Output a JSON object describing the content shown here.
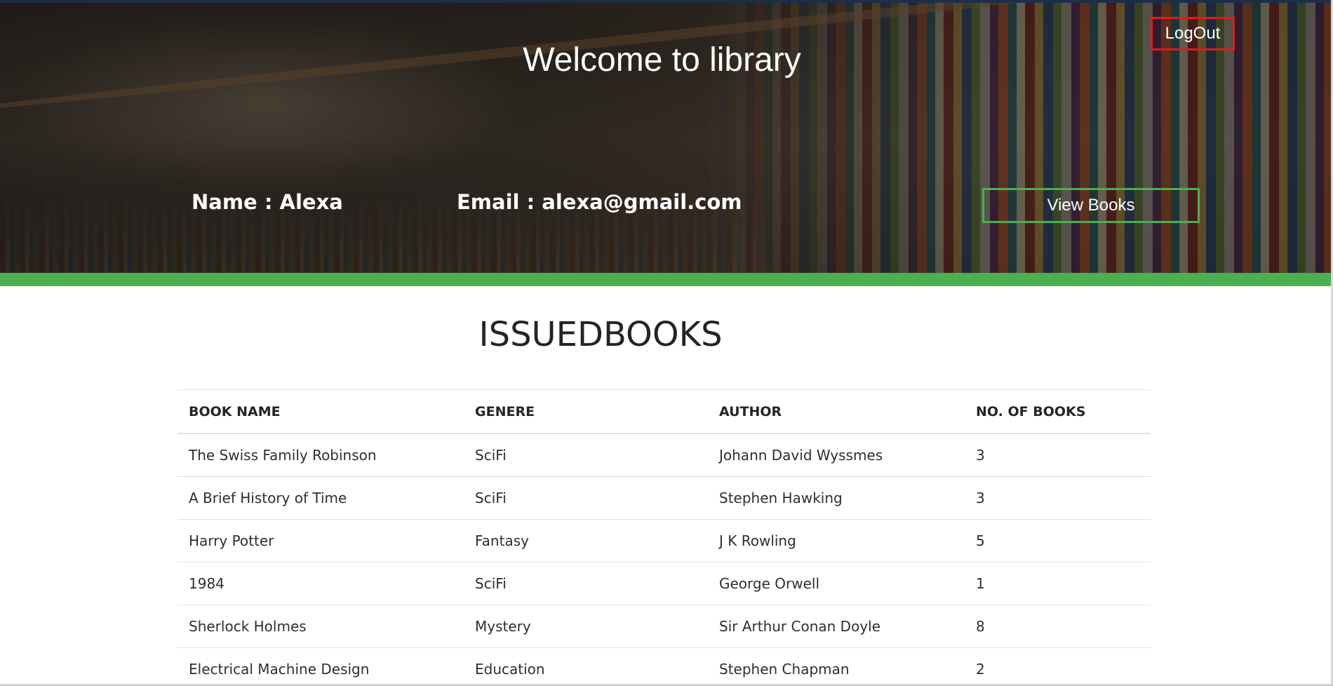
{
  "header": {
    "welcome_title": "Welcome to library",
    "logout_label": "LogOut",
    "name_text": "Name : Alexa",
    "email_text": "Email : alexa@gmail.com",
    "view_books_label": "View Books"
  },
  "colors": {
    "logout_border": "#e01b1b",
    "accent_green": "#4caf50",
    "text_dark": "#212529"
  },
  "issued_books": {
    "title": "ISSUEDBOOKS",
    "columns": [
      "BOOK NAME",
      "GENERE",
      "AUTHOR",
      "NO. OF BOOKS"
    ],
    "rows": [
      [
        "The Swiss Family Robinson",
        "SciFi",
        "Johann David Wyssmes",
        "3"
      ],
      [
        "A Brief History of Time",
        "SciFi",
        "Stephen Hawking",
        "3"
      ],
      [
        "Harry Potter",
        "Fantasy",
        "J K Rowling",
        "5"
      ],
      [
        "1984",
        "SciFi",
        "George Orwell",
        "1"
      ],
      [
        "Sherlock Holmes",
        "Mystery",
        "Sir Arthur Conan Doyle",
        "8"
      ],
      [
        "Electrical Machine Design",
        "Education",
        "Stephen Chapman",
        "2"
      ]
    ]
  }
}
